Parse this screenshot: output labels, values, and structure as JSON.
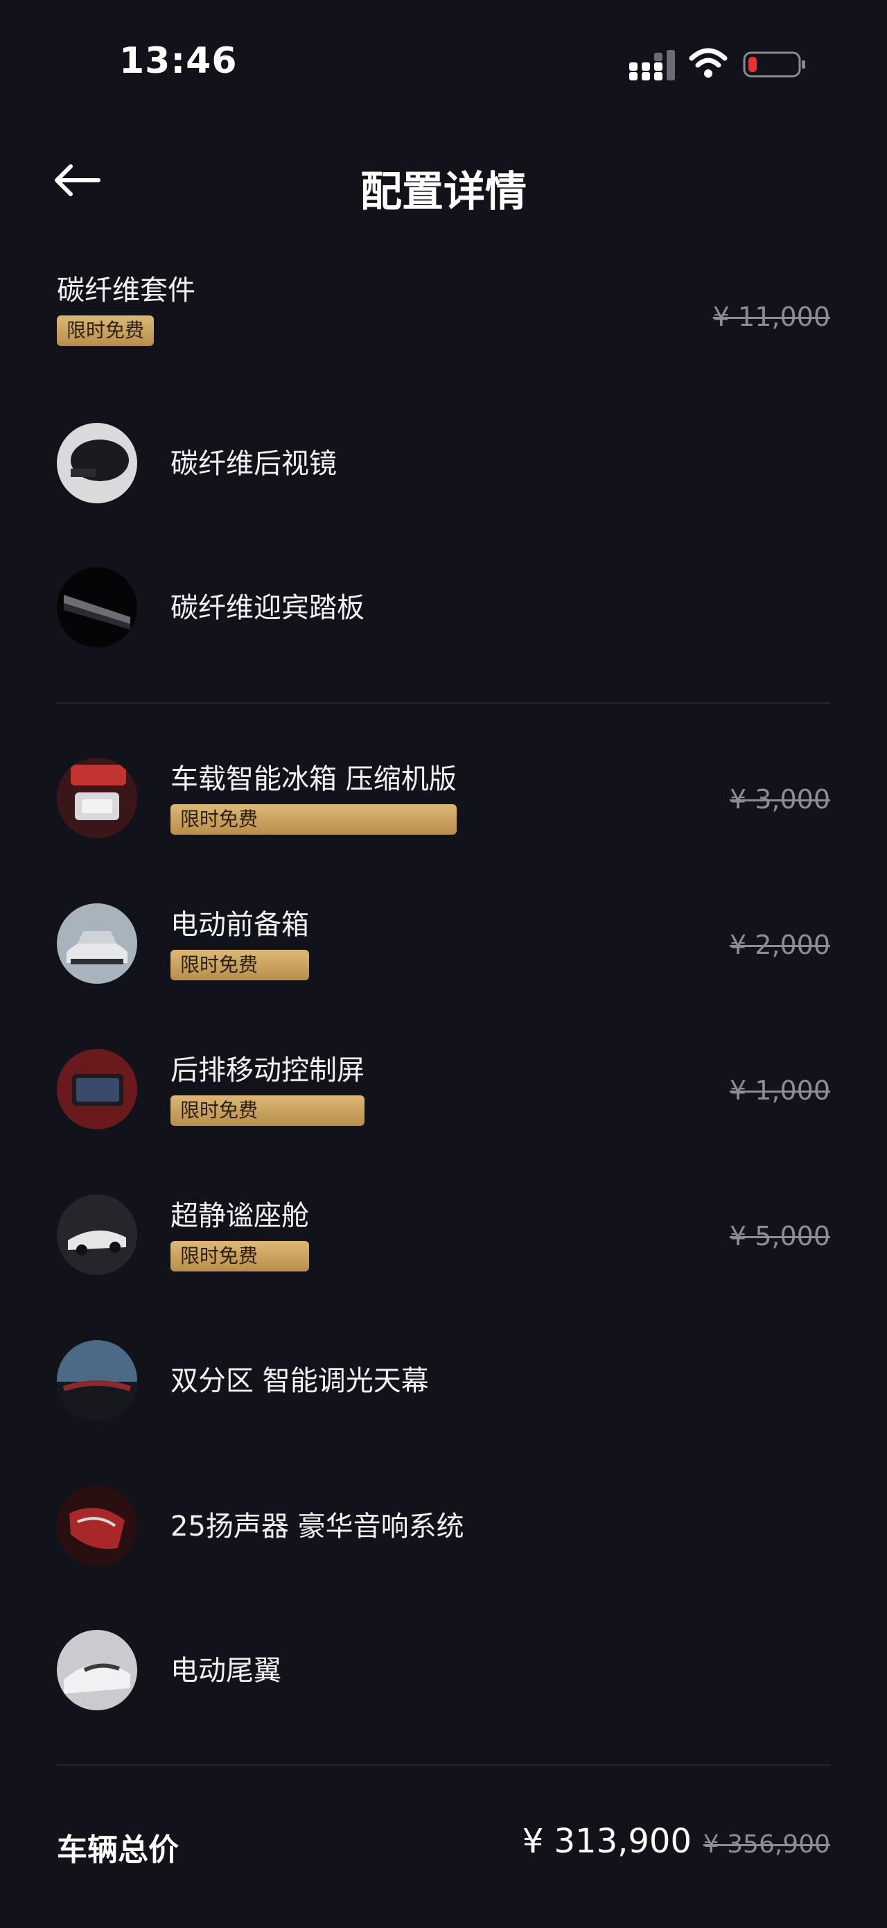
{
  "status": {
    "time": "13:46"
  },
  "nav": {
    "title": "配置详情"
  },
  "carbon_group": {
    "name": "碳纤维套件",
    "badge": "限时免费",
    "price": "¥ 11,000",
    "items": [
      {
        "name": "碳纤维后视镜",
        "icon": "mirror-thumb"
      },
      {
        "name": "碳纤维迎宾踏板",
        "icon": "sill-thumb"
      }
    ]
  },
  "options": [
    {
      "name": "车载智能冰箱 压缩机版",
      "badge": "限时免费",
      "price": "¥ 3,000",
      "icon": "fridge-thumb"
    },
    {
      "name": "电动前备箱",
      "badge": "限时免费",
      "price": "¥ 2,000",
      "icon": "frunk-thumb"
    },
    {
      "name": "后排移动控制屏",
      "badge": "限时免费",
      "price": "¥ 1,000",
      "icon": "screen-thumb"
    },
    {
      "name": "超静谧座舱",
      "badge": "限时免费",
      "price": "¥ 5,000",
      "icon": "cabin-thumb"
    },
    {
      "name": "双分区 智能调光天幕",
      "icon": "roof-thumb"
    },
    {
      "name": "25扬声器 豪华音响系统",
      "icon": "speaker-thumb"
    },
    {
      "name": "电动尾翼",
      "icon": "spoiler-thumb"
    }
  ],
  "footer": {
    "label": "车辆总价",
    "price": "¥ 313,900",
    "original_price": "¥ 356,900"
  },
  "colors": {
    "background": "#12131a",
    "badge": "#c9a262",
    "muted": "#8c8d94"
  }
}
